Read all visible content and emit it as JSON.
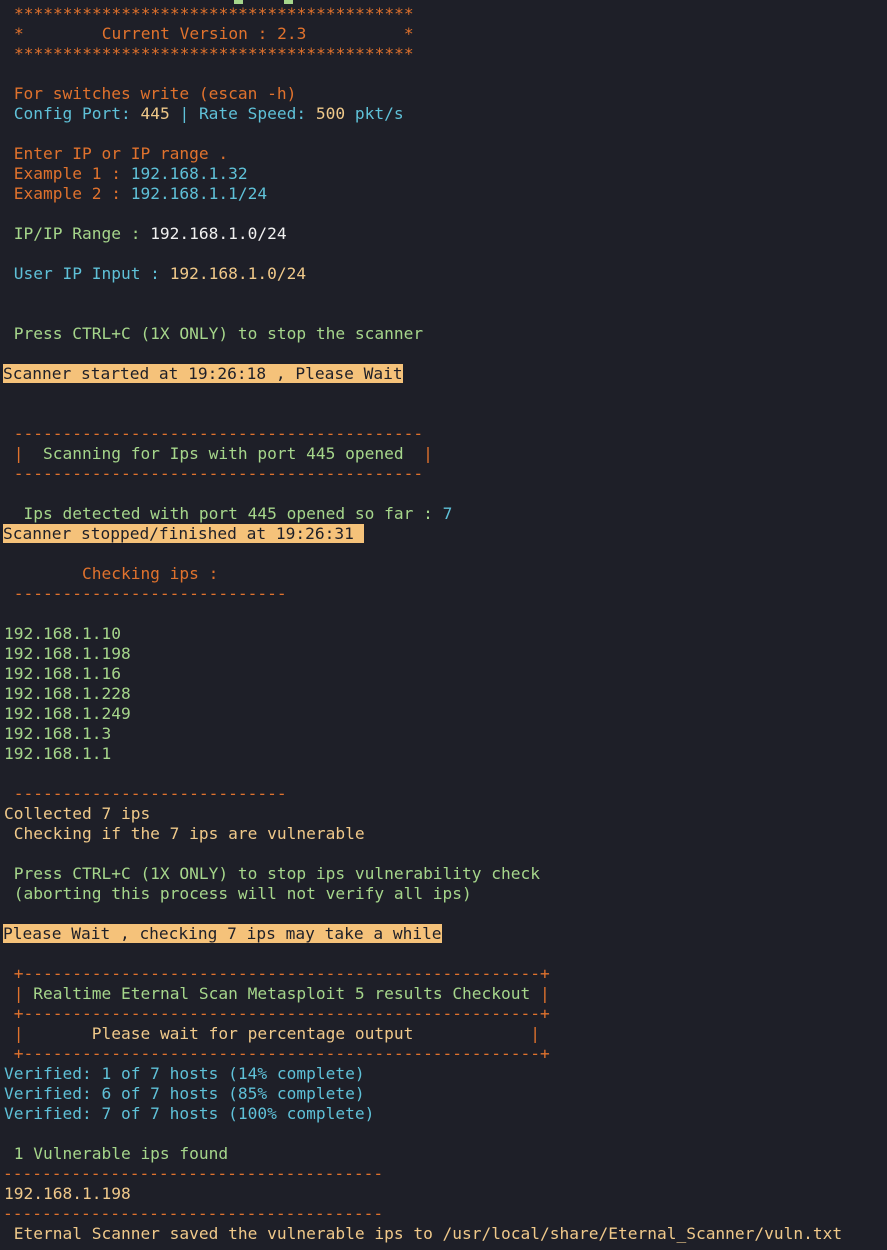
{
  "banner": {
    "stars": "*****************************************",
    "version_line": "*        Current Version : 2.3          *"
  },
  "help": {
    "switches": " For switches write (escan -h)",
    "config_label_port": " Config Port: ",
    "config_port": "445",
    "config_sep": " | Rate Speed: ",
    "rate": "500",
    "rate_unit": " pkt/s"
  },
  "input_help": {
    "prompt": " Enter IP or IP range .",
    "ex1_label": " Example 1 : ",
    "ex1_value": "192.168.1.32",
    "ex2_label": " Example 2 : ",
    "ex2_value": "192.168.1.1/24"
  },
  "ip_range": {
    "label": " IP/IP Range : ",
    "value": "192.168.1.0/24"
  },
  "user_input": {
    "label": " User IP Input : ",
    "value": "192.168.1.0/24"
  },
  "stop_hint": " Press CTRL+C (1X ONLY) to stop the scanner",
  "scan_started": "Scanner started at 19:26:18 , Please Wait",
  "scan_box": {
    "rule": " ------------------------------------------",
    "left": " |  ",
    "text": "Scanning for Ips with port 445 opened",
    "right": "  |"
  },
  "detected": {
    "label": "  Ips detected with port 445 opened so far : ",
    "count": "7"
  },
  "scan_stopped": "Scanner stopped/finished at 19:26:31 ",
  "checking": {
    "title": "        Checking ips :",
    "rule": " ----------------------------"
  },
  "ips": [
    "192.168.1.10",
    "192.168.1.198",
    "192.168.1.16",
    "192.168.1.228",
    "192.168.1.249",
    "192.168.1.3",
    "192.168.1.1"
  ],
  "collected": "Collected 7 ips",
  "checking_vuln": " Checking if the 7 ips are vulnerable",
  "vuln_stop_hint": " Press CTRL+C (1X ONLY) to stop ips vulnerability check",
  "vuln_abort_note": " (aborting this process will not verify all ips)",
  "please_wait": "Please Wait , checking 7 ips may take a while",
  "results_box": {
    "rule": " +-----------------------------------------------------+",
    "title_left": " | ",
    "title": "Realtime Eternal Scan Metasploit 5 results Checkout",
    "title_right": " |",
    "wait_left": " |       ",
    "wait": "Please wait for percentage output",
    "wait_right": "            |"
  },
  "verified": [
    "Verified: 1 of 7 hosts (14% complete)",
    "Verified: 6 of 7 hosts (85% complete)",
    "Verified: 7 of 7 hosts (100% complete)"
  ],
  "vuln_found": " 1 Vulnerable ips found",
  "vuln_rule": "---------------------------------------",
  "vuln_ips": [
    "192.168.1.198"
  ],
  "saved_msg": " Eternal Scanner saved the vulnerable ips to /usr/local/share/Eternal_Scanner/vuln.txt"
}
